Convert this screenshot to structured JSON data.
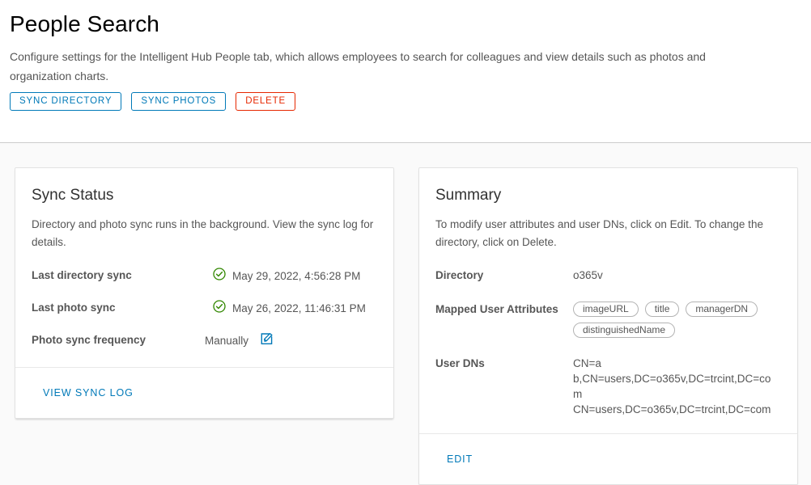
{
  "header": {
    "title": "People Search",
    "description": "Configure settings for the Intelligent Hub People tab, which allows employees to search for colleagues and view details such as photos and organization charts.",
    "buttons": {
      "sync_directory": "SYNC DIRECTORY",
      "sync_photos": "SYNC PHOTOS",
      "delete": "DELETE"
    }
  },
  "sync_status": {
    "title": "Sync Status",
    "description": "Directory and photo sync runs in the background. View the sync log for details.",
    "rows": [
      {
        "label": "Last directory sync",
        "value": "May 29, 2022, 4:56:28 PM",
        "icon": "check-circle-icon"
      },
      {
        "label": "Last photo sync",
        "value": "May 26, 2022, 11:46:31 PM",
        "icon": "check-circle-icon"
      },
      {
        "label": "Photo sync frequency",
        "value": "Manually",
        "icon": "pencil-square-icon"
      }
    ],
    "footer_link": "VIEW SYNC LOG"
  },
  "summary": {
    "title": "Summary",
    "description": "To modify user attributes and user DNs, click on Edit. To change the directory, click on Delete.",
    "directory_label": "Directory",
    "directory_value": "o365v",
    "attributes_label": "Mapped User Attributes",
    "attributes": [
      "imageURL",
      "title",
      "managerDN",
      "distinguishedName"
    ],
    "user_dns_label": "User DNs",
    "user_dns": [
      "CN=a",
      "b,CN=users,DC=o365v,DC=trcint,DC=com",
      "CN=users,DC=o365v,DC=trcint,DC=com"
    ],
    "footer_link": "EDIT"
  },
  "colors": {
    "accent": "#0079b8",
    "danger": "#e62700",
    "success": "#318700",
    "text": "#565656",
    "page_bg": "#fafafa"
  }
}
